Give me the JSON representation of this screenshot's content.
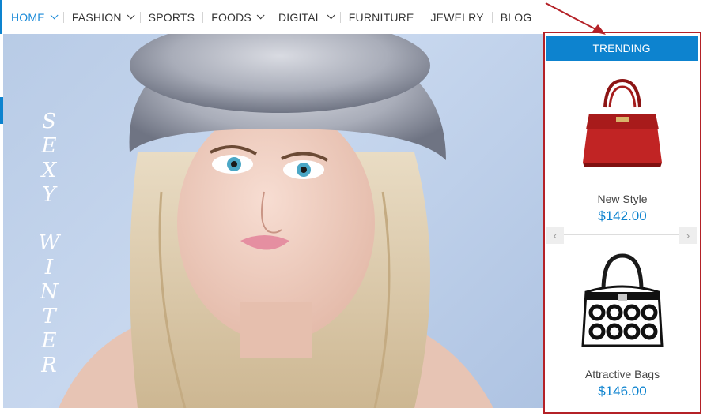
{
  "nav": {
    "items": [
      {
        "label": "HOME",
        "has_dropdown": true,
        "active": true
      },
      {
        "label": "FASHION",
        "has_dropdown": true,
        "active": false
      },
      {
        "label": "SPORTS",
        "has_dropdown": false,
        "active": false
      },
      {
        "label": "FOODS",
        "has_dropdown": true,
        "active": false
      },
      {
        "label": "DIGITAL",
        "has_dropdown": true,
        "active": false
      },
      {
        "label": "FURNITURE",
        "has_dropdown": false,
        "active": false
      },
      {
        "label": "JEWELRY",
        "has_dropdown": false,
        "active": false
      },
      {
        "label": "BLOG",
        "has_dropdown": false,
        "active": false
      }
    ]
  },
  "hero": {
    "vertical_text_line1": "SEXY",
    "vertical_text_line2": "WINTER"
  },
  "trending": {
    "title": "TRENDING",
    "products": [
      {
        "name": "New Style",
        "price": "$142.00",
        "image": "red-handbag"
      },
      {
        "name": "Attractive Bags",
        "price": "$146.00",
        "image": "black-white-circle-handbag"
      }
    ],
    "prev_icon": "chevron-left-icon",
    "next_icon": "chevron-right-icon"
  },
  "colors": {
    "accent": "#0d83cf",
    "highlight_border": "#b42127"
  }
}
